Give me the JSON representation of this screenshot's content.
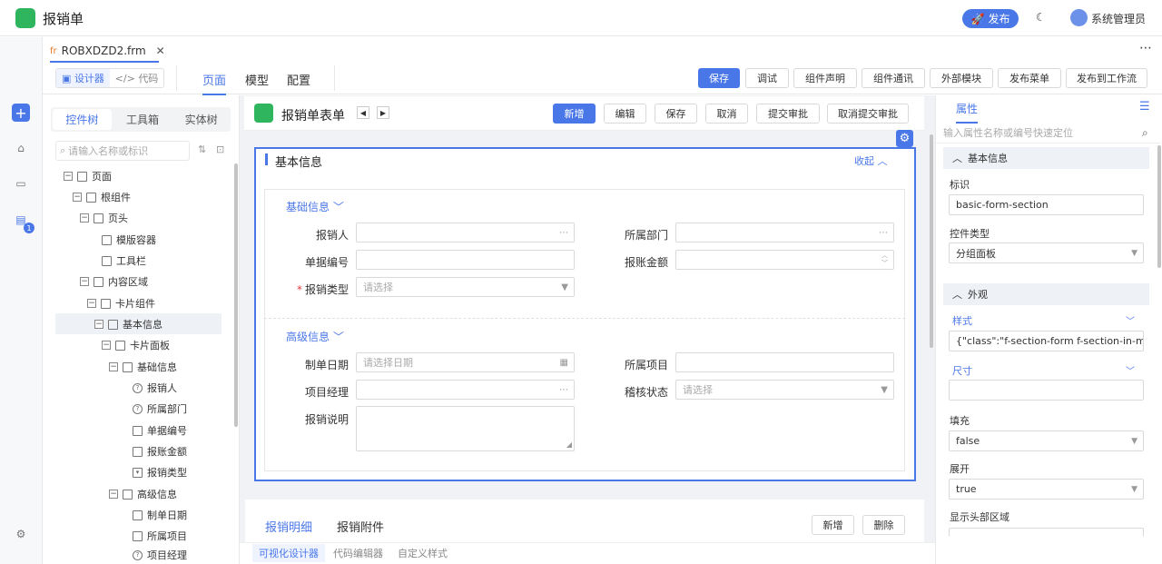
{
  "app": {
    "title": "报销单",
    "publish": "发布",
    "user": "系统管理员"
  },
  "file_tab": {
    "prefix": "fr",
    "name": "ROBXDZD2.frm",
    "close": "✕"
  },
  "modes": {
    "designer": "设计器",
    "code": "代码"
  },
  "top_tabs": [
    "页面",
    "模型",
    "配置"
  ],
  "toolbar_buttons": [
    "保存",
    "调试",
    "组件声明",
    "组件通讯",
    "外部模块",
    "发布菜单",
    "发布到工作流"
  ],
  "left_panel": {
    "tabs": [
      "控件树",
      "工具箱",
      "实体树"
    ],
    "search_placeholder": "请输入名称或标识",
    "tree": [
      "页面",
      "根组件",
      "页头",
      "模版容器",
      "工具栏",
      "内容区域",
      "卡片组件",
      "基本信息",
      "卡片面板",
      "基础信息",
      "报销人",
      "所属部门",
      "单据编号",
      "报账金额",
      "报销类型",
      "高级信息",
      "制单日期",
      "所属项目",
      "项目经理"
    ]
  },
  "form": {
    "title": "报销单表单",
    "buttons": [
      "新增",
      "编辑",
      "保存",
      "取消",
      "提交审批",
      "取消提交审批"
    ],
    "section_title": "基本信息",
    "collapse": "收起",
    "basic_heading": "基础信息",
    "advanced_heading": "高级信息",
    "labels": {
      "reimburser": "报销人",
      "department": "所属部门",
      "doc_no": "单据编号",
      "amount": "报账金额",
      "reimb_type": "报销类型",
      "create_date": "制单日期",
      "project": "所属项目",
      "pm": "项目经理",
      "audit_status": "稽核状态",
      "remark": "报销说明"
    },
    "placeholders": {
      "select": "请选择",
      "date": "请选择日期"
    }
  },
  "detail": {
    "tabs": [
      "报销明细",
      "报销附件"
    ],
    "add": "新增",
    "delete": "删除"
  },
  "bottom_tabs": [
    "可视化设计器",
    "代码编辑器",
    "自定义样式"
  ],
  "right_panel": {
    "tab": "属性",
    "search_placeholder": "输入属性名称或编号快速定位",
    "group_basic": "基本信息",
    "label_id": "标识",
    "value_id": "basic-form-section",
    "label_type": "控件类型",
    "value_type": "分组面板",
    "group_appearance": "外观",
    "label_style": "样式",
    "value_style": "{\"class\":\"f-section-form f-section-in-mainsubcard\"}",
    "label_size": "尺寸",
    "label_fill": "填充",
    "value_fill": "false",
    "label_expand": "展开",
    "value_expand": "true",
    "label_header": "显示头部区域"
  }
}
